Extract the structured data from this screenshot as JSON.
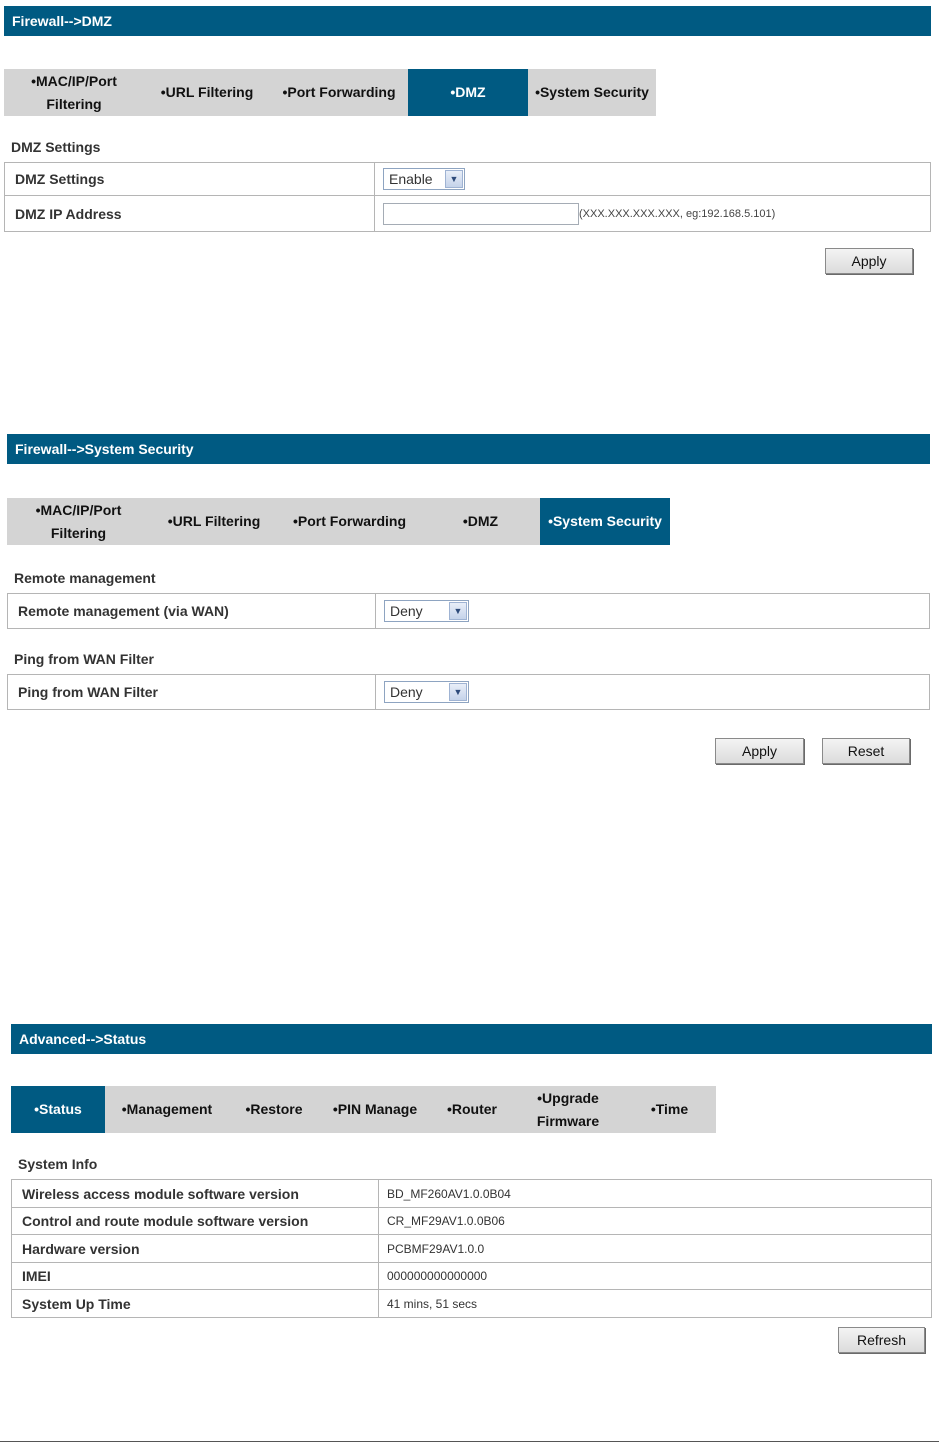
{
  "dmz_panel": {
    "title": "Firewall-->DMZ",
    "tabs": [
      {
        "line1": "•MAC/IP/Port",
        "line2": "Filtering"
      },
      {
        "line1": "•URL Filtering",
        "line2": ""
      },
      {
        "line1": "•Port Forwarding",
        "line2": ""
      },
      {
        "line1": "•DMZ",
        "line2": ""
      },
      {
        "line1": "•System Security",
        "line2": ""
      }
    ],
    "active_tab": "•DMZ",
    "section_label": "DMZ Settings",
    "rows": {
      "settings_label": "DMZ Settings",
      "settings_value": "Enable",
      "ip_label": "DMZ IP Address",
      "ip_value": "",
      "ip_hint": "(XXX.XXX.XXX.XXX, eg:192.168.5.101)"
    },
    "apply_label": "Apply"
  },
  "security_panel": {
    "title": "Firewall-->System Security",
    "tabs": [
      {
        "line1": "•MAC/IP/Port",
        "line2": "Filtering"
      },
      {
        "line1": "•URL Filtering",
        "line2": ""
      },
      {
        "line1": "•Port Forwarding",
        "line2": ""
      },
      {
        "line1": "•DMZ",
        "line2": ""
      },
      {
        "line1": "•System Security",
        "line2": ""
      }
    ],
    "active_tab": "•System Security",
    "remote_section_label": "Remote management",
    "remote_label": "Remote management (via WAN)",
    "remote_value": "Deny",
    "ping_section_label": "Ping from WAN Filter",
    "ping_label": "Ping from WAN Filter",
    "ping_value": "Deny",
    "apply_label": "Apply",
    "reset_label": "Reset"
  },
  "status_panel": {
    "title": "Advanced-->Status",
    "tabs": [
      {
        "line1": "•Status",
        "line2": ""
      },
      {
        "line1": "•Management",
        "line2": ""
      },
      {
        "line1": "•Restore",
        "line2": ""
      },
      {
        "line1": "•PIN Manage",
        "line2": ""
      },
      {
        "line1": "•Router",
        "line2": ""
      },
      {
        "line1": "•Upgrade",
        "line2": "Firmware"
      },
      {
        "line1": "•Time",
        "line2": ""
      }
    ],
    "active_tab": "•Status",
    "section_label": "System Info",
    "rows": [
      {
        "label": "Wireless access module software version",
        "value": "BD_MF260AV1.0.0B04"
      },
      {
        "label": "Control and route module software version",
        "value": "CR_MF29AV1.0.0B06"
      },
      {
        "label": "Hardware version",
        "value": "PCBMF29AV1.0.0"
      },
      {
        "label": "IMEI",
        "value": "000000000000000"
      },
      {
        "label": "System Up Time",
        "value": "41 mins, 51 secs"
      }
    ],
    "refresh_label": "Refresh"
  },
  "colors": {
    "accent": "#005a82",
    "tab_bg": "#d4d4d4"
  }
}
